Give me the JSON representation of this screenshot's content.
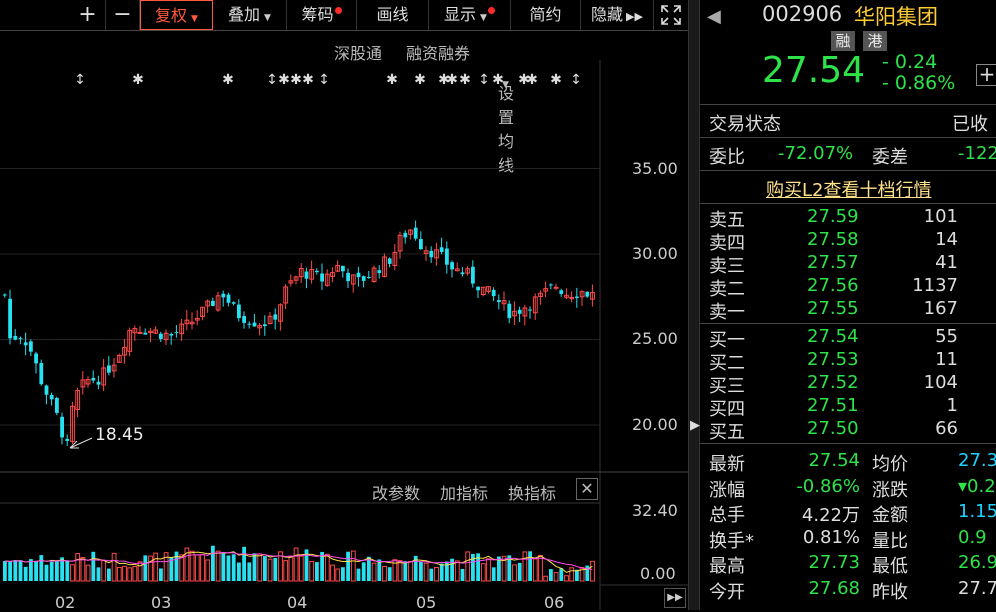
{
  "toolbar": {
    "plus": "+",
    "minus": "−",
    "fuquan": "复权",
    "diejia": "叠加",
    "chouma": "筹码",
    "huaxian": "画线",
    "xianshi": "显示",
    "jianyue": "简约",
    "yincang": "隐藏"
  },
  "subbar": {
    "shengutong": "深股通",
    "rongzi": "融资融券",
    "junxian": "设置均线"
  },
  "indicator_bar": {
    "gaicanshu": "改参数",
    "jiazhibiao": "加指标",
    "huanzhibiao": "换指标"
  },
  "stock": {
    "code": "002906",
    "name": "华阳集团",
    "badge_rong": "融",
    "badge_gang": "港",
    "price": "27.54",
    "change": "- 0.24",
    "change_pct": "- 0.86%"
  },
  "trade_status": {
    "label": "交易状态",
    "value": "已收"
  },
  "weibi": {
    "label": "委比",
    "value": "-72.07%",
    "label2": "委差",
    "value2": "-122"
  },
  "l2_link": "购买L2查看十档行情",
  "sell_orders": [
    {
      "label": "卖五",
      "price": "27.59",
      "vol": "101"
    },
    {
      "label": "卖四",
      "price": "27.58",
      "vol": "14"
    },
    {
      "label": "卖三",
      "price": "27.57",
      "vol": "41"
    },
    {
      "label": "卖二",
      "price": "27.56",
      "vol": "1137"
    },
    {
      "label": "卖一",
      "price": "27.55",
      "vol": "167"
    }
  ],
  "buy_orders": [
    {
      "label": "买一",
      "price": "27.54",
      "vol": "55"
    },
    {
      "label": "买二",
      "price": "27.53",
      "vol": "11"
    },
    {
      "label": "买三",
      "price": "27.52",
      "vol": "104"
    },
    {
      "label": "买四",
      "price": "27.51",
      "vol": "1"
    },
    {
      "label": "买五",
      "price": "27.50",
      "vol": "66"
    }
  ],
  "stats": [
    {
      "l1": "最新",
      "v1": "27.54",
      "l2": "均价",
      "v2": "27.3"
    },
    {
      "l1": "涨幅",
      "v1": "-0.86%",
      "l2": "涨跌",
      "v2": "▾0.2"
    },
    {
      "l1": "总手",
      "v1": "4.22万",
      "l2": "金额",
      "v2": "1.15"
    },
    {
      "l1": "换手*",
      "v1": "0.81%",
      "l2": "量比",
      "v2": "0.9"
    },
    {
      "l1": "最高",
      "v1": "27.73",
      "l2": "最低",
      "v2": "26.9"
    },
    {
      "l1": "今开",
      "v1": "27.68",
      "l2": "昨收",
      "v2": "27.7"
    }
  ],
  "chart_data": {
    "type": "candlestick",
    "y_ticks": [
      "35.00",
      "30.00",
      "25.00",
      "20.00"
    ],
    "volume_ticks": [
      "32.40",
      "0.00"
    ],
    "x_ticks": [
      "02",
      "03",
      "04",
      "05",
      "06"
    ],
    "low_annotation": "18.45",
    "colors": {
      "up": "#ff4a4a",
      "down": "#27e0f0",
      "ma1": "#ffe14a",
      "ma2": "#ff4af0"
    }
  }
}
